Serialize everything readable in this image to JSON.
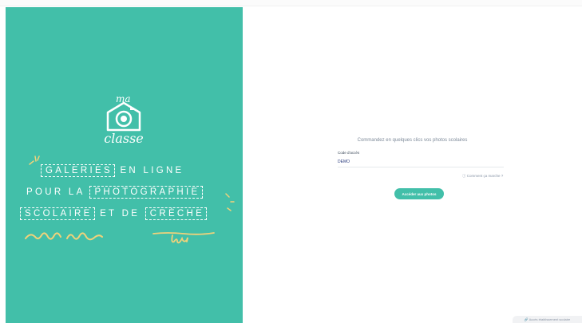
{
  "brand": {
    "logo_top": "ma",
    "logo_bottom": "classe"
  },
  "tagline": {
    "line1": {
      "boxed": "GALERIES",
      "rest": "EN LIGNE"
    },
    "line2": {
      "plain": "POUR LA",
      "boxed": "PHOTOGRAPHIE"
    },
    "line3": {
      "boxed1": "SCOLAIRE",
      "middle": "ET DE",
      "boxed2": "CRÈCHE"
    }
  },
  "login": {
    "subtitle": "Commandez en quelques clics vos photos scolaires",
    "code_label": "Code d'accès",
    "code_value": "DEMO",
    "help_link": "Comment ça marche ?",
    "submit_label": "Accéder aux photos"
  },
  "footer": {
    "school_access_label": "Accès établissement scolaire"
  },
  "colors": {
    "brand_green": "#42bfa9",
    "accent_yellow": "#f1d27a",
    "text_dark": "#2a3b7d"
  }
}
